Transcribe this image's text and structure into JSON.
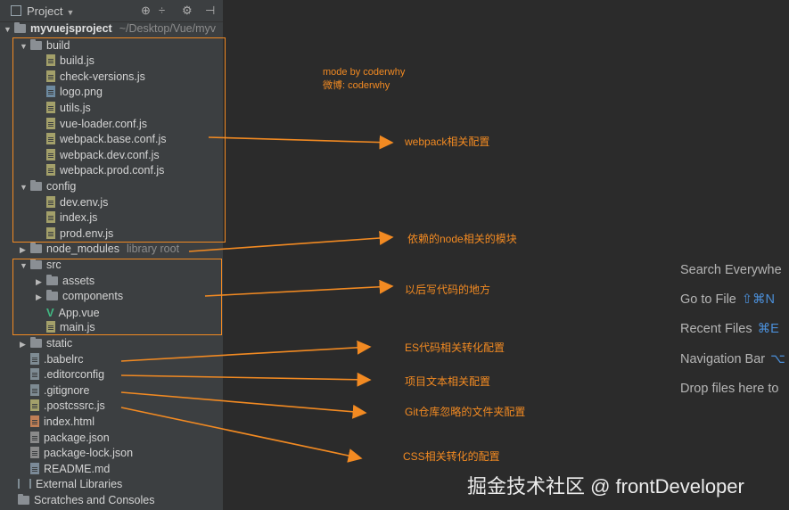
{
  "toolbar": {
    "title": "Project",
    "icons": [
      "crosshair-icon",
      "collapse-icon",
      "gear-icon",
      "hide-icon"
    ]
  },
  "tree": {
    "root_name": "myvuejsproject",
    "root_path": "~/Desktop/Vue/myv",
    "items": [
      {
        "label": "build",
        "type": "folder",
        "expanded": true
      },
      {
        "label": "build.js",
        "type": "js"
      },
      {
        "label": "check-versions.js",
        "type": "js"
      },
      {
        "label": "logo.png",
        "type": "png"
      },
      {
        "label": "utils.js",
        "type": "js"
      },
      {
        "label": "vue-loader.conf.js",
        "type": "js"
      },
      {
        "label": "webpack.base.conf.js",
        "type": "js"
      },
      {
        "label": "webpack.dev.conf.js",
        "type": "js"
      },
      {
        "label": "webpack.prod.conf.js",
        "type": "js"
      },
      {
        "label": "config",
        "type": "folder",
        "expanded": true
      },
      {
        "label": "dev.env.js",
        "type": "js"
      },
      {
        "label": "index.js",
        "type": "js"
      },
      {
        "label": "prod.env.js",
        "type": "js"
      },
      {
        "label": "node_modules",
        "type": "folder",
        "expanded": false,
        "hint": "library root"
      },
      {
        "label": "src",
        "type": "folder",
        "expanded": true
      },
      {
        "label": "assets",
        "type": "folder",
        "expanded": false
      },
      {
        "label": "components",
        "type": "folder",
        "expanded": false
      },
      {
        "label": "App.vue",
        "type": "vue"
      },
      {
        "label": "main.js",
        "type": "js"
      },
      {
        "label": "static",
        "type": "folder",
        "expanded": false
      },
      {
        "label": ".babelrc",
        "type": "config"
      },
      {
        "label": ".editorconfig",
        "type": "config"
      },
      {
        "label": ".gitignore",
        "type": "config"
      },
      {
        "label": ".postcssrc.js",
        "type": "js"
      },
      {
        "label": "index.html",
        "type": "html"
      },
      {
        "label": "package.json",
        "type": "json"
      },
      {
        "label": "package-lock.json",
        "type": "json"
      },
      {
        "label": "README.md",
        "type": "md"
      }
    ],
    "external_libraries": "External Libraries",
    "scratches": "Scratches and Consoles"
  },
  "annotations": {
    "author_line1": "mode by coderwhy",
    "author_line2": "微博: coderwhy",
    "webpack": "webpack相关配置",
    "node_modules": "依赖的node相关的模块",
    "src": "以后写代码的地方",
    "babelrc": "ES代码相关转化配置",
    "editorconfig": "项目文本相关配置",
    "gitignore": "Git仓库忽略的文件夹配置",
    "postcss": "CSS相关转化的配置",
    "accent_color": "#f28a22"
  },
  "right_panel": {
    "items": [
      {
        "label": "Search Everywhe",
        "shortcut": ""
      },
      {
        "label": "Go to File",
        "shortcut": "⇧⌘N"
      },
      {
        "label": "Recent Files",
        "shortcut": "⌘E"
      },
      {
        "label": "Navigation Bar",
        "shortcut": "⌥"
      },
      {
        "label": "Drop files here to",
        "shortcut": ""
      }
    ]
  },
  "watermark": "掘金技术社区 @ frontDeveloper"
}
